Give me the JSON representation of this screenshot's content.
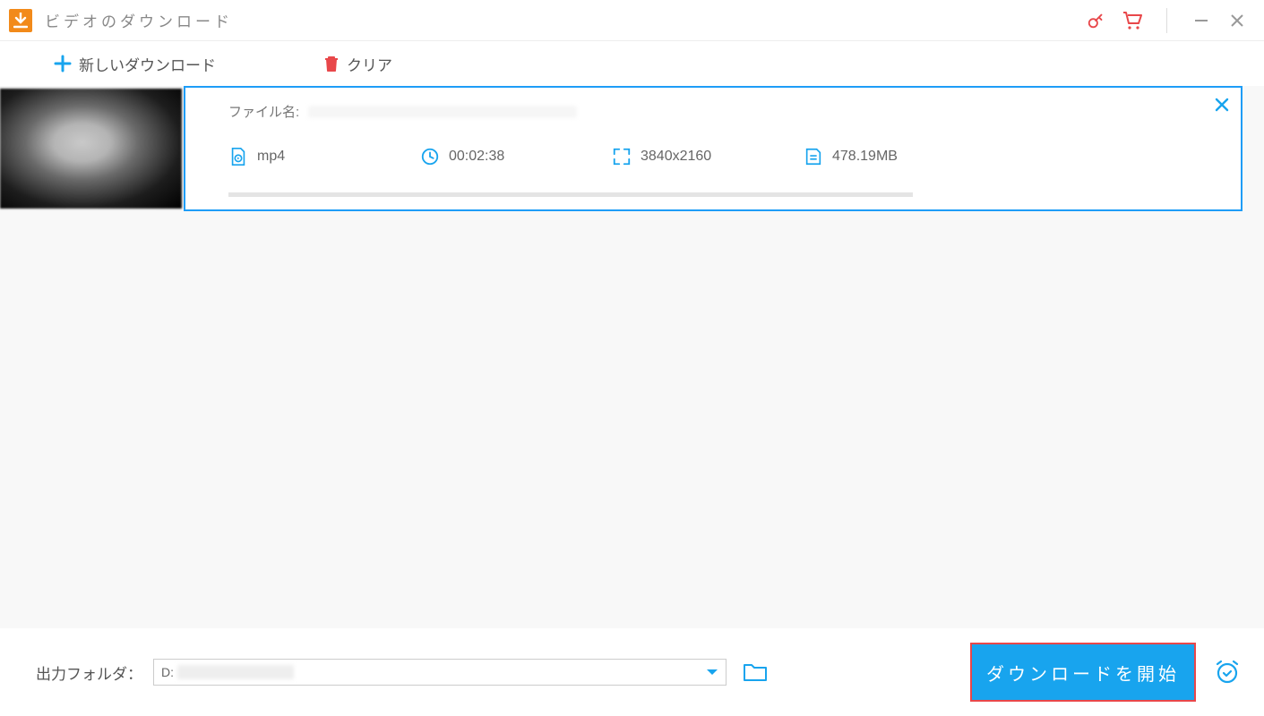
{
  "titlebar": {
    "app_title": "ビデオのダウンロード"
  },
  "toolbar": {
    "new_download": "新しいダウンロード",
    "clear": "クリア"
  },
  "item": {
    "filename_label": "ファイル名:",
    "format": "mp4",
    "duration": "00:02:38",
    "resolution": "3840x2160",
    "filesize": "478.19MB"
  },
  "footer": {
    "output_label": "出力フォルダ：",
    "output_path_prefix": "D:",
    "start_button": "ダウンロードを開始"
  },
  "colors": {
    "accent": "#18a4ee",
    "danger": "#e8474a",
    "brand": "#f28a1a"
  },
  "icons": {
    "app": "download-arrow",
    "key": "key-icon",
    "cart": "cart-icon",
    "minimize": "minimize-icon",
    "close": "close-icon",
    "plus": "plus-icon",
    "trash": "trash-icon",
    "play": "play-file-icon",
    "clock": "clock-icon",
    "expand": "expand-icon",
    "filesize": "file-icon",
    "x": "x-icon",
    "dropdown": "chevron-down-icon",
    "folder": "folder-icon",
    "alarm": "alarm-clock-icon"
  }
}
